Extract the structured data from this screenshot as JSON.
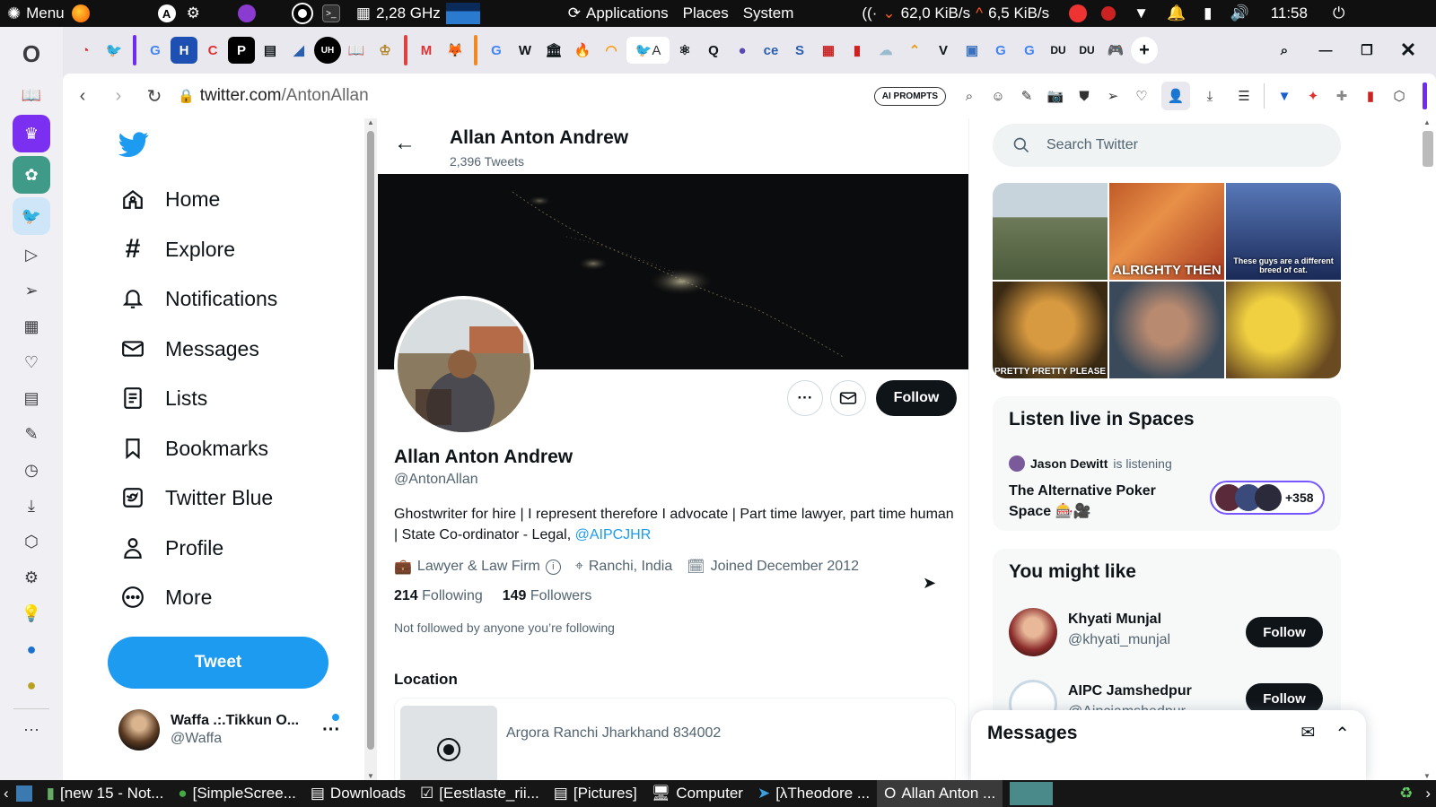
{
  "desktop_panel": {
    "menu_label": "Menu",
    "cpu_freq": "2,28 GHz",
    "applications": "Applications",
    "places": "Places",
    "system": "System",
    "net_down": "62,0 KiB/s",
    "net_up": "6,5 KiB/s",
    "clock": "11:58"
  },
  "browser": {
    "url_host": "twitter.com",
    "url_path": "/AntonAllan",
    "ai_prompts_label": "AI PROMPTS"
  },
  "twitter": {
    "nav": [
      {
        "label": "Home",
        "icon": "home-icon"
      },
      {
        "label": "Explore",
        "icon": "hashtag-icon"
      },
      {
        "label": "Notifications",
        "icon": "bell-icon"
      },
      {
        "label": "Messages",
        "icon": "envelope-icon"
      },
      {
        "label": "Lists",
        "icon": "list-icon"
      },
      {
        "label": "Bookmarks",
        "icon": "bookmark-icon"
      },
      {
        "label": "Twitter Blue",
        "icon": "twitter-blue-icon"
      },
      {
        "label": "Profile",
        "icon": "person-icon"
      },
      {
        "label": "More",
        "icon": "more-circle-icon"
      }
    ],
    "tweet_button": "Tweet",
    "account": {
      "name": "Waffa .:.Tikkun O...",
      "handle": "@Waffa"
    },
    "header": {
      "title": "Allan Anton Andrew",
      "tweets": "2,396 Tweets"
    },
    "profile": {
      "name": "Allan Anton Andrew",
      "handle": "@AntonAllan",
      "bio": "Ghostwriter for hire | I represent therefore I advocate | Part time lawyer, part time human | State Co-ordinator - Legal, ",
      "bio_link": "@AIPCJHR",
      "category": "Lawyer & Law Firm",
      "location": "Ranchi, India",
      "joined": "Joined December 2012",
      "following_count": "214",
      "following_label": "Following",
      "followers_count": "149",
      "followers_label": "Followers",
      "not_followed": "Not followed by anyone you’re following",
      "follow_label": "Follow",
      "location_section": "Location",
      "location_address": "Argora Ranchi Jharkhand 834002"
    },
    "search_placeholder": "Search Twitter",
    "gifs": [
      "",
      "ALRIGHTY THEN",
      "These guys are a different breed of cat.",
      "PRETTY PRETTY PLEASE",
      "",
      ""
    ],
    "spaces": {
      "title": "Listen live in Spaces",
      "listener": "Jason Dewitt",
      "listening": "is listening",
      "space_title": "The Alternative Poker Space 🎰🎥",
      "count": "+358"
    },
    "might_like": {
      "title": "You might like",
      "users": [
        {
          "name": "Khyati Munjal",
          "handle": "@khyati_munjal",
          "button": "Follow"
        },
        {
          "name": "AIPC Jamshedpur",
          "handle": "@Aipcjamshedpur",
          "button": "Follow"
        }
      ]
    },
    "messages_bar": "Messages"
  },
  "taskbar": [
    {
      "label": "[new 15 - Not...",
      "active": false
    },
    {
      "label": "[SimpleScree...",
      "active": false
    },
    {
      "label": "Downloads",
      "active": false
    },
    {
      "label": "[Eestlaste_rii...",
      "active": false
    },
    {
      "label": "[Pictures]",
      "active": false
    },
    {
      "label": "Computer",
      "active": false
    },
    {
      "label": "[λTheodore ...",
      "active": false
    },
    {
      "label": "Allan Anton ...",
      "active": true
    }
  ],
  "colors": {
    "twitter_blue": "#1d9bf0",
    "panel_bg": "#101010",
    "text": "#0f1419",
    "secondary": "#536471"
  }
}
